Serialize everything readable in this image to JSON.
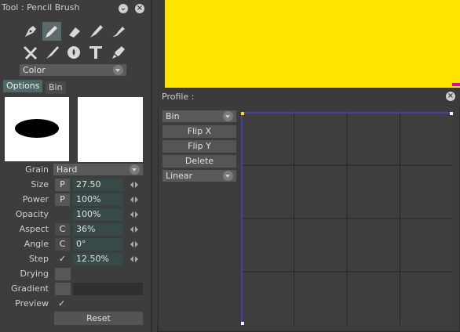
{
  "tool_panel": {
    "title": "Tool : Pencil Brush",
    "color_dropdown": "Color",
    "tabs": [
      "Options",
      "Bin"
    ],
    "properties": [
      {
        "label": "Grain",
        "kind": "dropdown",
        "value": "Hard"
      },
      {
        "label": "Size",
        "chip": "P",
        "value": "27.50"
      },
      {
        "label": "Power",
        "chip": "P",
        "value": "100%"
      },
      {
        "label": "Opacity",
        "chip": "",
        "value": "100%"
      },
      {
        "label": "Aspect",
        "chip": "C",
        "value": "36%"
      },
      {
        "label": "Angle",
        "chip": "C",
        "value": "0°"
      },
      {
        "label": "Step",
        "chip": "✓",
        "value": "12.50%"
      },
      {
        "label": "Drying",
        "kind": "empty"
      },
      {
        "label": "Gradient",
        "kind": "gradient"
      },
      {
        "label": "Preview",
        "kind": "check",
        "value": "✓"
      }
    ],
    "reset_label": "Reset"
  },
  "profile": {
    "title": "Profile :",
    "bin_dropdown": "Bin",
    "buttons": [
      "Flip X",
      "Flip Y",
      "Delete"
    ],
    "interp_dropdown": "Linear",
    "grid": {
      "cols": 4,
      "rows": 4
    }
  },
  "colors": {
    "canvas": "#ffe400",
    "selection_line": "#4a3cff",
    "field": "#384a48"
  }
}
